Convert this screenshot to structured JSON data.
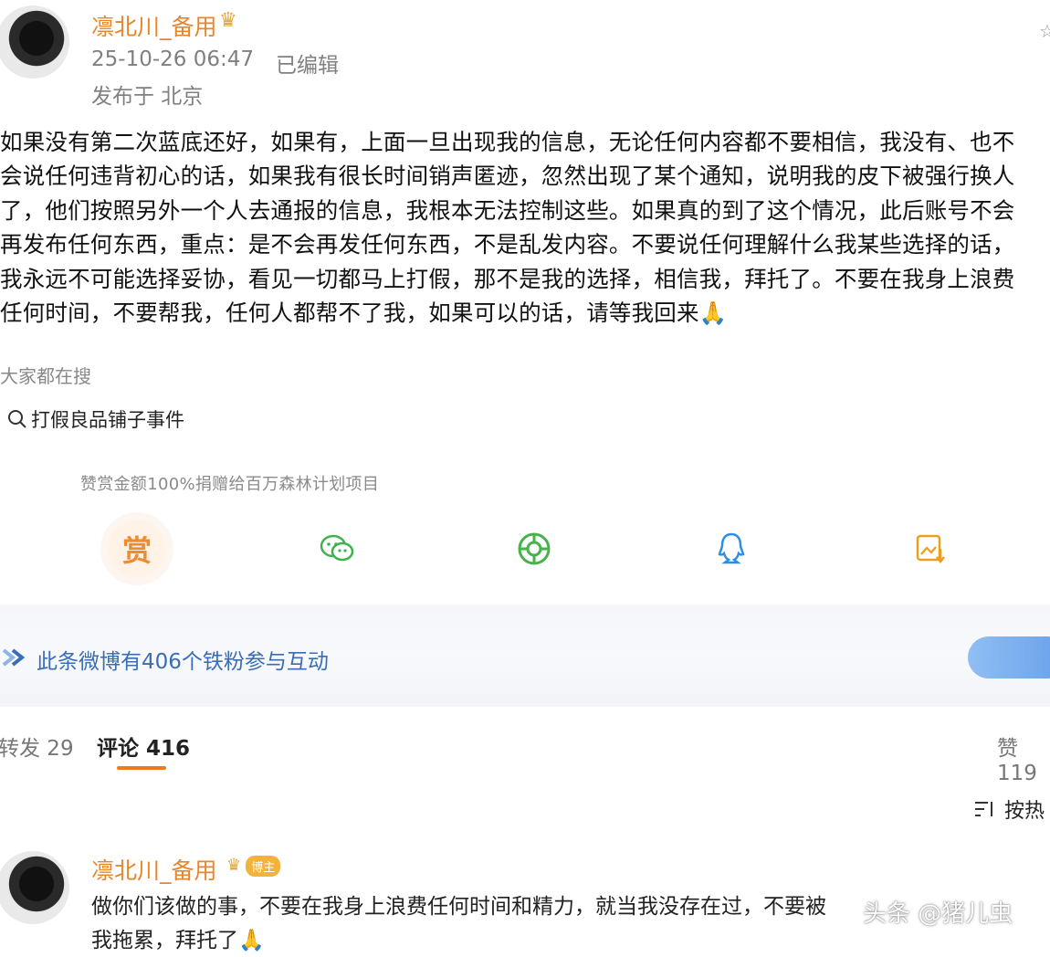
{
  "post": {
    "username": "凛北川_备用",
    "crown_icon": "crown-icon",
    "timestamp": "25-10-26 06:47",
    "edited": "已编辑",
    "location": "发布于 北京",
    "content_lines": [
      "如果没有第二次蓝底还好，如果有，上面一旦出现我的信息，无论任何内容都不要相信，我没有、也不",
      "会说任何违背初心的话，如果我有很长时间销声匿迹，忽然出现了某个通知，说明我的皮下被强行换人",
      "了，他们按照另外一个人去通报的信息，我根本无法控制这些。如果真的到了这个情况，此后账号不会",
      "再发布任何东西，重点：是不会再发任何东西，不是乱发内容。不要说任何理解什么我某些选择的话，",
      "我永远不可能选择妥协，看见一切都马上打假，那不是我的选择，相信我，拜托了。不要在我身上浪费",
      "任何时间，不要帮我，任何人都帮不了我，如果可以的话，请等我回来🙏"
    ]
  },
  "search": {
    "label": "大家都在搜",
    "item": "打假良品铺子事件"
  },
  "reward": {
    "note": "赞赏金额100%捐赠给百万森林计划项目",
    "button": "赏"
  },
  "share_icons": [
    "wechat-icon",
    "moments-icon",
    "qq-icon",
    "save-image-icon"
  ],
  "fans": {
    "text": "此条微博有406个铁粉参与互动"
  },
  "tabs": {
    "repost": "转发 29",
    "comment": "评论 416",
    "like": "赞 119"
  },
  "sort": {
    "label": "按热"
  },
  "comment": {
    "username": "凛北川_备用",
    "badge": "博主",
    "line1": "做你们该做的事，不要在我身上浪费任何时间和精力，就当我没存在过，不要被",
    "line2": "我拖累，拜托了🙏"
  },
  "watermark": "头条 @猪儿虫"
}
